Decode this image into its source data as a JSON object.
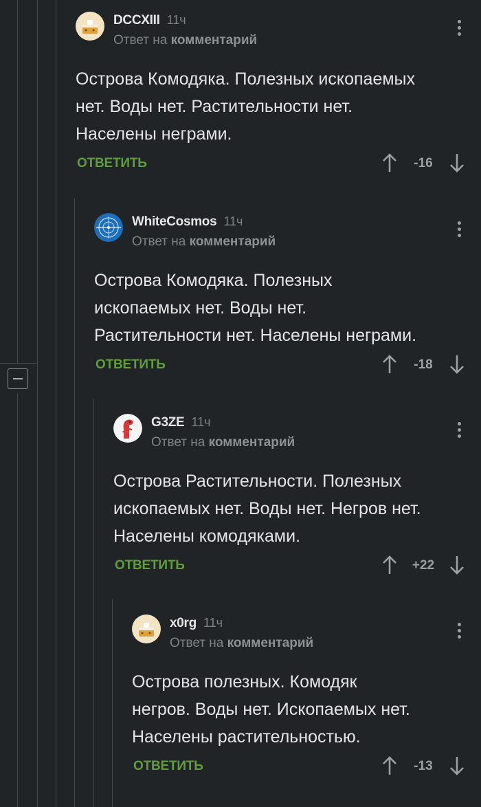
{
  "comments": [
    {
      "author": "DCCXIII",
      "time": "11ч",
      "reply_prefix": "Ответ на",
      "reply_link": "комментарий",
      "text_lines": [
        "Острова Комодяка. Полезных ископаемых",
        "нет. Воды нет. Растительности нет.",
        "Населены неграми."
      ],
      "reply_label": "ОТВЕТИТЬ",
      "score": "-16",
      "avatar": "cake-avatar-icon"
    },
    {
      "author": "WhiteCosmos",
      "time": "11ч",
      "reply_prefix": "Ответ на",
      "reply_link": "комментарий",
      "text_lines": [
        "Острова Комодяка. Полезных",
        "ископаемых нет. Воды нет.",
        "Растительности нет. Населены неграми."
      ],
      "reply_label": "ОТВЕТИТЬ",
      "score": "-18",
      "avatar": "crosshair-avatar-icon"
    },
    {
      "author": "G3ZE",
      "time": "11ч",
      "reply_prefix": "Ответ на",
      "reply_link": "комментарий",
      "text_lines": [
        "Острова Растительности. Полезных",
        "ископаемых нет. Воды нет. Негров нет.",
        "Населены комодяками."
      ],
      "reply_label": "ОТВЕТИТЬ",
      "score": "+22",
      "avatar": "dinosaur-avatar-icon"
    },
    {
      "author": "x0rg",
      "time": "11ч",
      "reply_prefix": "Ответ на",
      "reply_link": "комментарий",
      "text_lines": [
        "Острова полезных. Комодяк",
        "негров. Воды нет. Ископаемых нет.",
        "Населены растительностью."
      ],
      "reply_label": "ОТВЕТИТЬ",
      "score": "-13",
      "avatar": "cake-avatar-icon"
    }
  ],
  "colors": {
    "background": "#202426",
    "reply_green": "#5f9e3a",
    "thread_line": "#43494c"
  }
}
